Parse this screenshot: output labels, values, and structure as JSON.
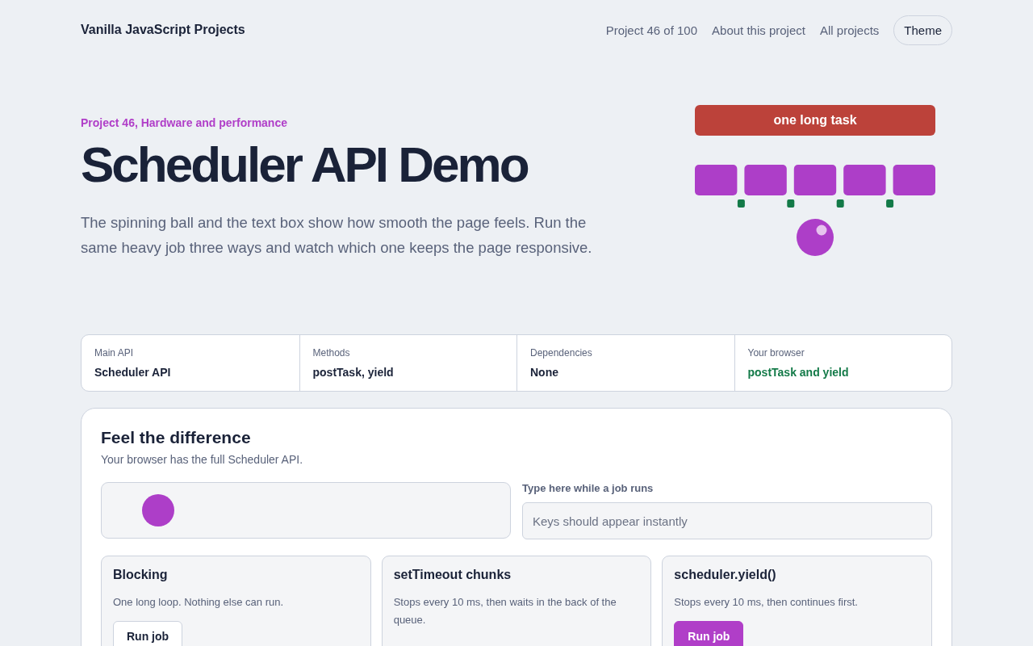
{
  "header": {
    "brand": "Vanilla JavaScript Projects",
    "links": [
      "Project 46 of 100",
      "About this project",
      "All projects"
    ],
    "theme_button": "Theme"
  },
  "hero": {
    "eyebrow": "Project 46, Hardware and performance",
    "title": "Scheduler API Demo",
    "description": "The spinning ball and the text box show how smooth the page feels. Run the same heavy job three ways and watch which one keeps the page responsive.",
    "illustration": {
      "long_task": "one long task"
    }
  },
  "facts": [
    {
      "label": "Main API",
      "value": "Scheduler API",
      "kind": "plain"
    },
    {
      "label": "Methods",
      "value": "postTask, yield",
      "kind": "plain"
    },
    {
      "label": "Dependencies",
      "value": "None",
      "kind": "plain"
    },
    {
      "label": "Your browser",
      "value": "postTask and yield",
      "kind": "supported"
    }
  ],
  "demo": {
    "title": "Feel the difference",
    "subtitle": "Your browser has the full Scheduler API.",
    "input_label": "Type here while a job runs",
    "input_placeholder": "Keys should appear instantly",
    "methods": [
      {
        "title": "Blocking",
        "description": "One long loop. Nothing else can run.",
        "button": "Run job",
        "kind": "secondary"
      },
      {
        "title": "setTimeout chunks",
        "description": "Stops every 10 ms, then waits in the back of the queue."
      },
      {
        "title": "scheduler.yield()",
        "description": "Stops every 10 ms, then continues first.",
        "button": "Run job",
        "kind": "primary"
      }
    ]
  }
}
